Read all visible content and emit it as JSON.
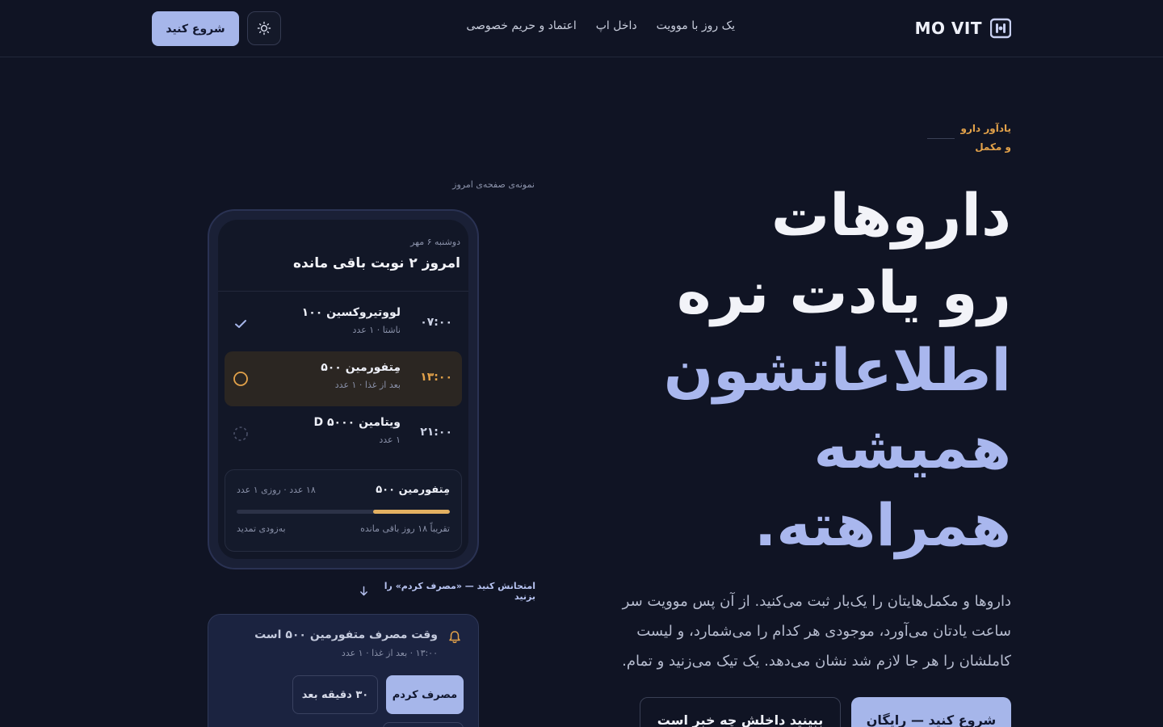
{
  "brand": {
    "name": "MO VIT"
  },
  "nav": {
    "items": [
      {
        "label": "یک روز با موویت"
      },
      {
        "label": "داخل اپ"
      },
      {
        "label": "اعتماد و حریم خصوصی"
      }
    ]
  },
  "header": {
    "start_label": "شروع کنید",
    "theme_icon": "sun-icon"
  },
  "hero": {
    "eyebrow_line1": "یادآور دارو",
    "eyebrow_line2": "و مکمل",
    "title_line1": "داروهات",
    "title_line2": "رو یادت نره",
    "title_line3": "اطلاعاتشون",
    "title_line4": "همیشه",
    "title_line5": "همراهته.",
    "subtitle": "داروها و مکمل‌هایتان را یک‌بار ثبت می‌کنید. از آن پس موویت سر ساعت یادتان می‌آورد، موجودی هر کدام را می‌شمارد، و لیست کاملشان را هر جا لازم شد نشان می‌دهد. یک تیک می‌زنید و تمام.",
    "cta_primary": "شروع کنید — رایگان",
    "cta_secondary": "ببینید داخلش چه خبر است"
  },
  "preview": {
    "caption": "نمونه‌ی صفحه‌ی امروز",
    "date": "دوشنبه ۶ مهر",
    "title": "امروز ۲ نوبت باقی مانده",
    "doses": [
      {
        "time": "۰۷:۰۰",
        "name": "لووتیروکسین ۱۰۰",
        "meta": "ناشتا · ۱ عدد",
        "status": "taken"
      },
      {
        "time": "۱۳:۰۰",
        "name": "مِتفورمین ۵۰۰",
        "meta": "بعد از غذا · ۱ عدد",
        "status": "due"
      },
      {
        "time": "۲۱:۰۰",
        "name": "ویتامین D ۵۰۰۰",
        "meta": "۱ عدد",
        "status": "upcoming"
      }
    ],
    "stock": {
      "name": "مِتفورمین ۵۰۰",
      "count": "۱۸ عدد · روزی ۱ عدد",
      "days_left": "تقریباً ۱۸ روز باقی مانده",
      "renew": "به‌زودی تمدید",
      "fill_fraction": 0.36,
      "fill_color": "#e3b061"
    }
  },
  "try_hint": {
    "label": "امتحانش کنید — «مصرف کردم» را بزنید",
    "icon": "arrow-down-icon"
  },
  "notification": {
    "icon": "bell-icon",
    "title": "وقت مصرف متفورمین ۵۰۰ است",
    "meta": "۱۳:۰۰ · بعد از غذا · ۱ عدد",
    "ack_label": "مصرف کردم",
    "snooze_label": "۳۰ دقیقه بعد"
  },
  "colors": {
    "background": "#101424",
    "accent": "#a6b6ea",
    "warning": "#e3a24a"
  }
}
